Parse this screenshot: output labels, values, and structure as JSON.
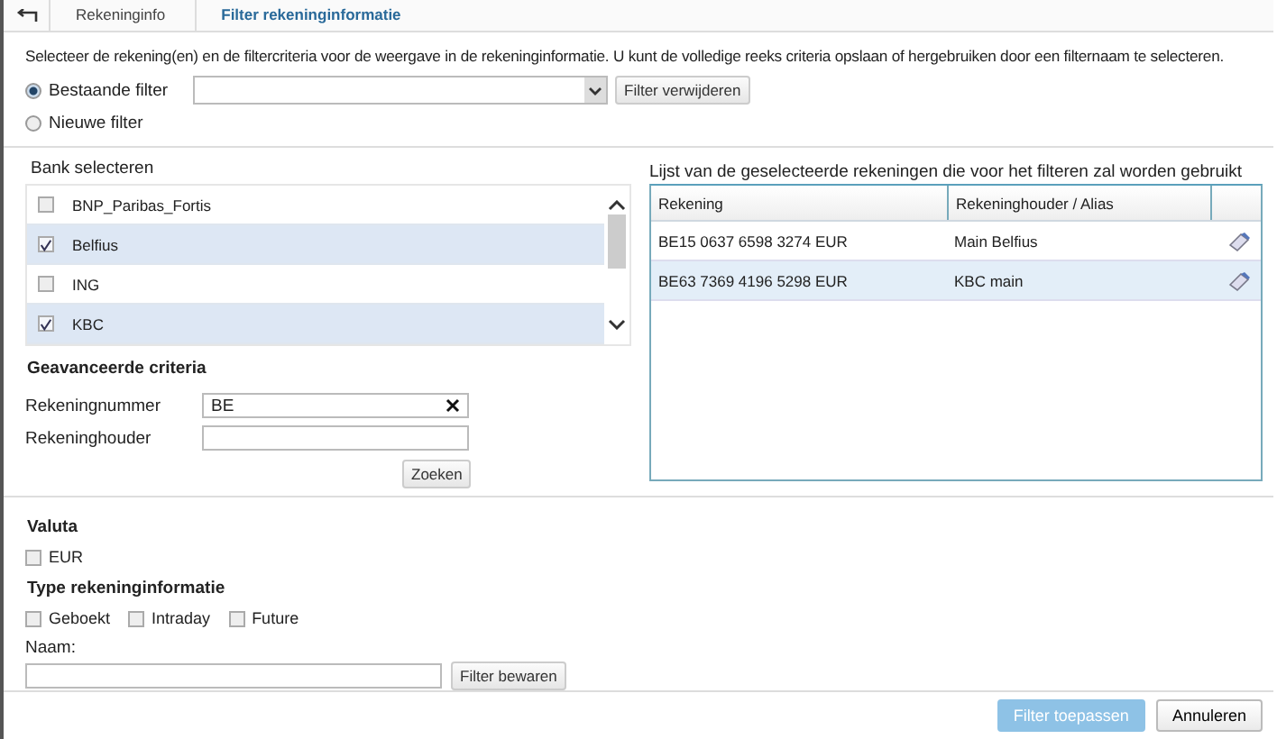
{
  "breadcrumb": {
    "items": [
      {
        "label": "Rekeninginfo",
        "selected": false
      },
      {
        "label": "Filter rekeninginformatie",
        "selected": true
      }
    ]
  },
  "intro": "Selecteer de rekening(en) en de filtercriteria voor de weergave in de rekeninginformatie. U kunt de volledige reeks criteria opslaan of hergebruiken door een filternaam te selecteren.",
  "filter_mode": [
    {
      "label": "Bestaande filter",
      "selected": true
    },
    {
      "label": "Nieuwe filter",
      "selected": false
    }
  ],
  "delete_filter_button": "Filter verwijderen",
  "bank_list": {
    "title": "Bank selecteren",
    "items": [
      {
        "label": "BNP_Paribas_Fortis",
        "checked": false
      },
      {
        "label": "Belfius",
        "checked": true
      },
      {
        "label": "ING",
        "checked": false
      },
      {
        "label": "KBC",
        "checked": true
      }
    ]
  },
  "advanced": {
    "title": "Geavanceerde criteria",
    "fields": [
      {
        "label": "Rekeningnummer",
        "value": "BE",
        "clearable": true
      },
      {
        "label": "Rekeninghouder",
        "clearable": false
      }
    ],
    "search_button": "Zoeken"
  },
  "selected_accounts": {
    "title": "Lijst van de geselecteerde rekeningen die voor het filteren zal worden gebruikt",
    "columns": [
      "Rekening",
      "Rekeninghouder / Alias"
    ],
    "rows": [
      {
        "account": "BE15 0637 6598 3274 EUR",
        "holder": "Main Belfius",
        "selected": false
      },
      {
        "account": "BE63 7369 4196 5298 EUR",
        "holder": "KBC main",
        "selected": true
      }
    ]
  },
  "currency": {
    "title": "Valuta",
    "options": [
      {
        "label": "EUR",
        "checked": false
      }
    ]
  },
  "info_type": {
    "title": "Type rekeninginformatie",
    "options": [
      {
        "label": "Geboekt",
        "checked": false
      },
      {
        "label": "Intraday",
        "checked": false
      },
      {
        "label": "Future",
        "checked": false
      }
    ]
  },
  "name": {
    "label": "Naam:",
    "save_button": "Filter bewaren"
  },
  "footer_buttons": [
    {
      "label": "Filter toepassen",
      "kind": "primary"
    },
    {
      "label": "Annuleren",
      "kind": "secondary"
    }
  ]
}
